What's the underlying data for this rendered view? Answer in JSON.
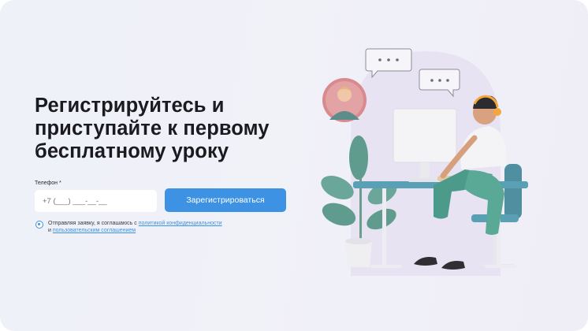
{
  "headline": "Регистрируйтесь и приступайте к первому бесплатному уроку",
  "form": {
    "phone_label": "Телефон *",
    "phone_placeholder": "+7 (___) ___-__-__",
    "submit_label": "Зарегистрироваться"
  },
  "consent": {
    "text_before": "Отправляя заявку, я соглашаюсь с ",
    "privacy_link": "политикой конфиденциальности",
    "text_middle": "и ",
    "terms_link": "пользовательским соглашением"
  },
  "colors": {
    "accent": "#3d92e3",
    "background": "#f0f1f8",
    "plant": "#5f9c8d",
    "desk": "#5aa0b4"
  }
}
